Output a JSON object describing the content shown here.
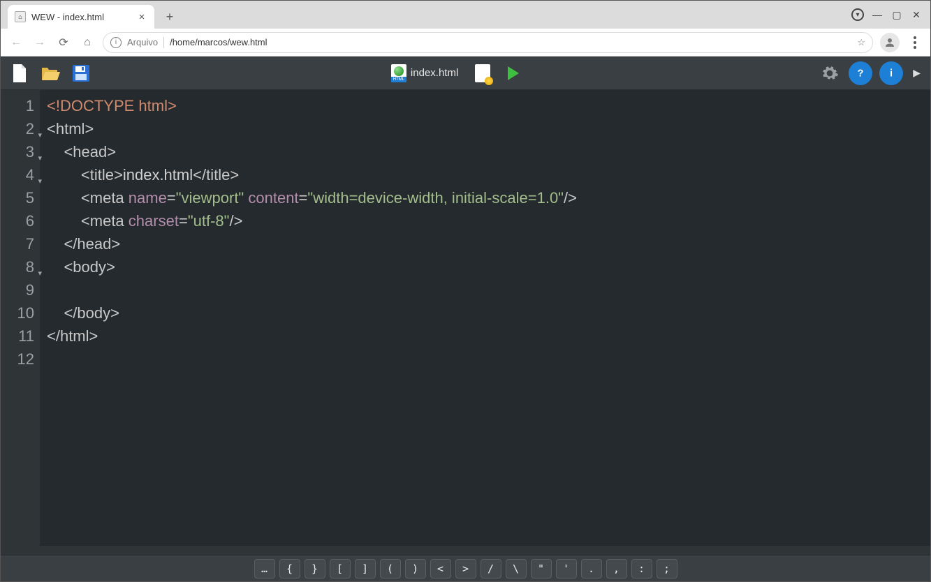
{
  "browser": {
    "tab_title": "WEW - index.html",
    "address_scheme": "Arquivo",
    "address_path": "/home/marcos/wew.html"
  },
  "app_toolbar": {
    "active_file": "index.html"
  },
  "editor": {
    "lines": [
      {
        "n": "1",
        "fold": false,
        "html": "<span class='c-doctype'>&lt;!DOCTYPE html&gt;</span>"
      },
      {
        "n": "2",
        "fold": true,
        "html": "<span class='c-tag'>&lt;html&gt;</span>"
      },
      {
        "n": "3",
        "fold": true,
        "html": "    <span class='c-tag'>&lt;head&gt;</span>"
      },
      {
        "n": "4",
        "fold": true,
        "html": "        <span class='c-tag'>&lt;title&gt;</span>index.html<span class='c-tag'>&lt;/title&gt;</span>"
      },
      {
        "n": "5",
        "fold": false,
        "html": "        <span class='c-tag'>&lt;meta</span> <span class='c-attr'>name</span>=<span class='c-str'>\"viewport\"</span> <span class='c-attr'>content</span>=<span class='c-str'>\"width=device-width, initial-scale=1.0\"</span><span class='c-tag'>/&gt;</span>"
      },
      {
        "n": "6",
        "fold": false,
        "html": "        <span class='c-tag'>&lt;meta</span> <span class='c-attr'>charset</span>=<span class='c-str'>\"utf-8\"</span><span class='c-tag'>/&gt;</span>"
      },
      {
        "n": "7",
        "fold": false,
        "html": "    <span class='c-tag'>&lt;/head&gt;</span>"
      },
      {
        "n": "8",
        "fold": true,
        "html": "    <span class='c-tag'>&lt;body&gt;</span>"
      },
      {
        "n": "9",
        "fold": false,
        "html": ""
      },
      {
        "n": "10",
        "fold": false,
        "html": "    <span class='c-tag'>&lt;/body&gt;</span>"
      },
      {
        "n": "11",
        "fold": false,
        "html": "<span class='c-tag'>&lt;/html&gt;</span>"
      },
      {
        "n": "12",
        "fold": false,
        "html": ""
      }
    ]
  },
  "symbar": [
    "…",
    "{",
    "}",
    "[",
    "]",
    "(",
    ")",
    "<",
    ">",
    "/",
    "\\",
    "\"",
    "'",
    ".",
    ",",
    ":",
    ";"
  ]
}
